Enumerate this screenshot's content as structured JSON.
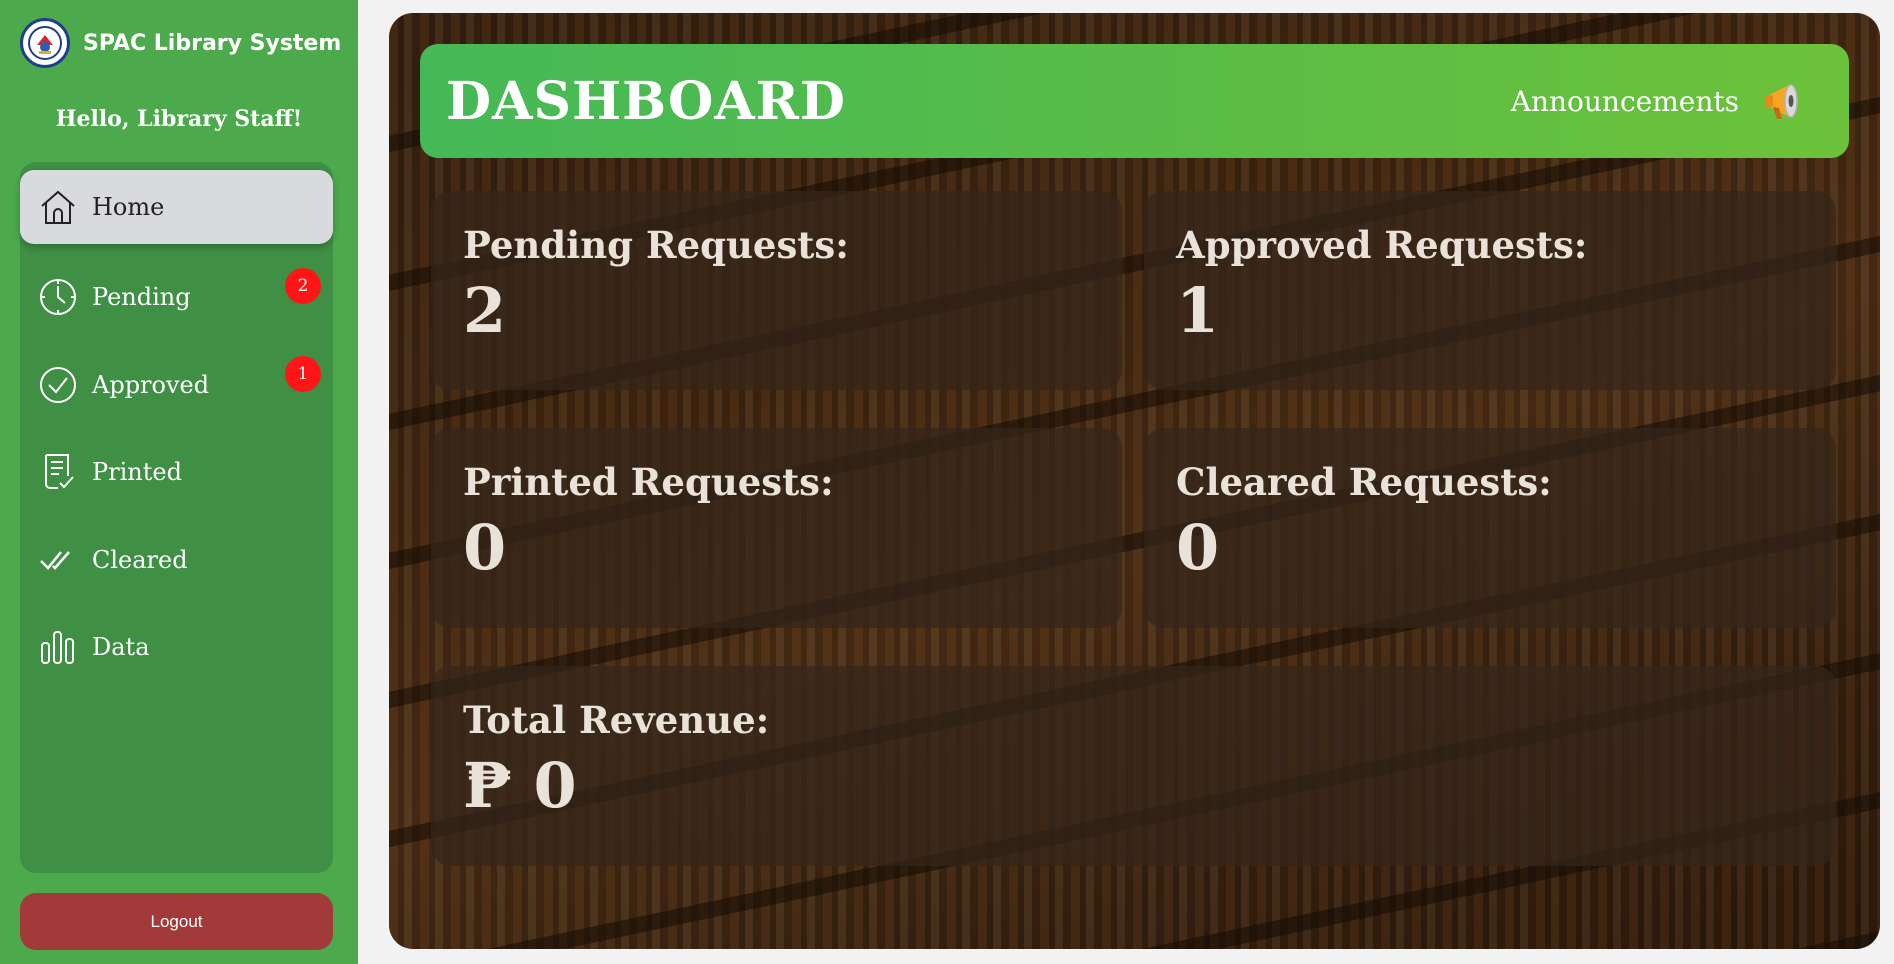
{
  "sidebar": {
    "brand": "SPAC Library System",
    "greeting": "Hello, Library Staff!",
    "items": [
      {
        "label": "Home",
        "icon": "home-icon",
        "active": true
      },
      {
        "label": "Pending",
        "icon": "clock-icon",
        "badge": "2"
      },
      {
        "label": "Approved",
        "icon": "check-circle-icon",
        "badge": "1"
      },
      {
        "label": "Printed",
        "icon": "printed-document-icon"
      },
      {
        "label": "Cleared",
        "icon": "double-check-icon"
      },
      {
        "label": "Data",
        "icon": "bar-chart-icon"
      }
    ],
    "logout_label": "Logout"
  },
  "header": {
    "title": "DASHBOARD",
    "announcements_label": "Announcements",
    "announcements_icon": "megaphone-icon"
  },
  "stats": {
    "pending": {
      "label": "Pending Requests:",
      "value": "2"
    },
    "approved": {
      "label": "Approved Requests:",
      "value": "1"
    },
    "printed": {
      "label": "Printed Requests:",
      "value": "0"
    },
    "cleared": {
      "label": "Cleared Requests:",
      "value": "0"
    },
    "revenue": {
      "label": "Total Revenue:",
      "value": "₱ 0"
    }
  },
  "colors": {
    "sidebar": "#4caa4c",
    "nav_panel": "#3f8f45",
    "active_item": "#d9dade",
    "badge": "#ff1515",
    "logout": "#a33a3a",
    "header_start": "#45b957",
    "header_end": "#6cc23a"
  }
}
